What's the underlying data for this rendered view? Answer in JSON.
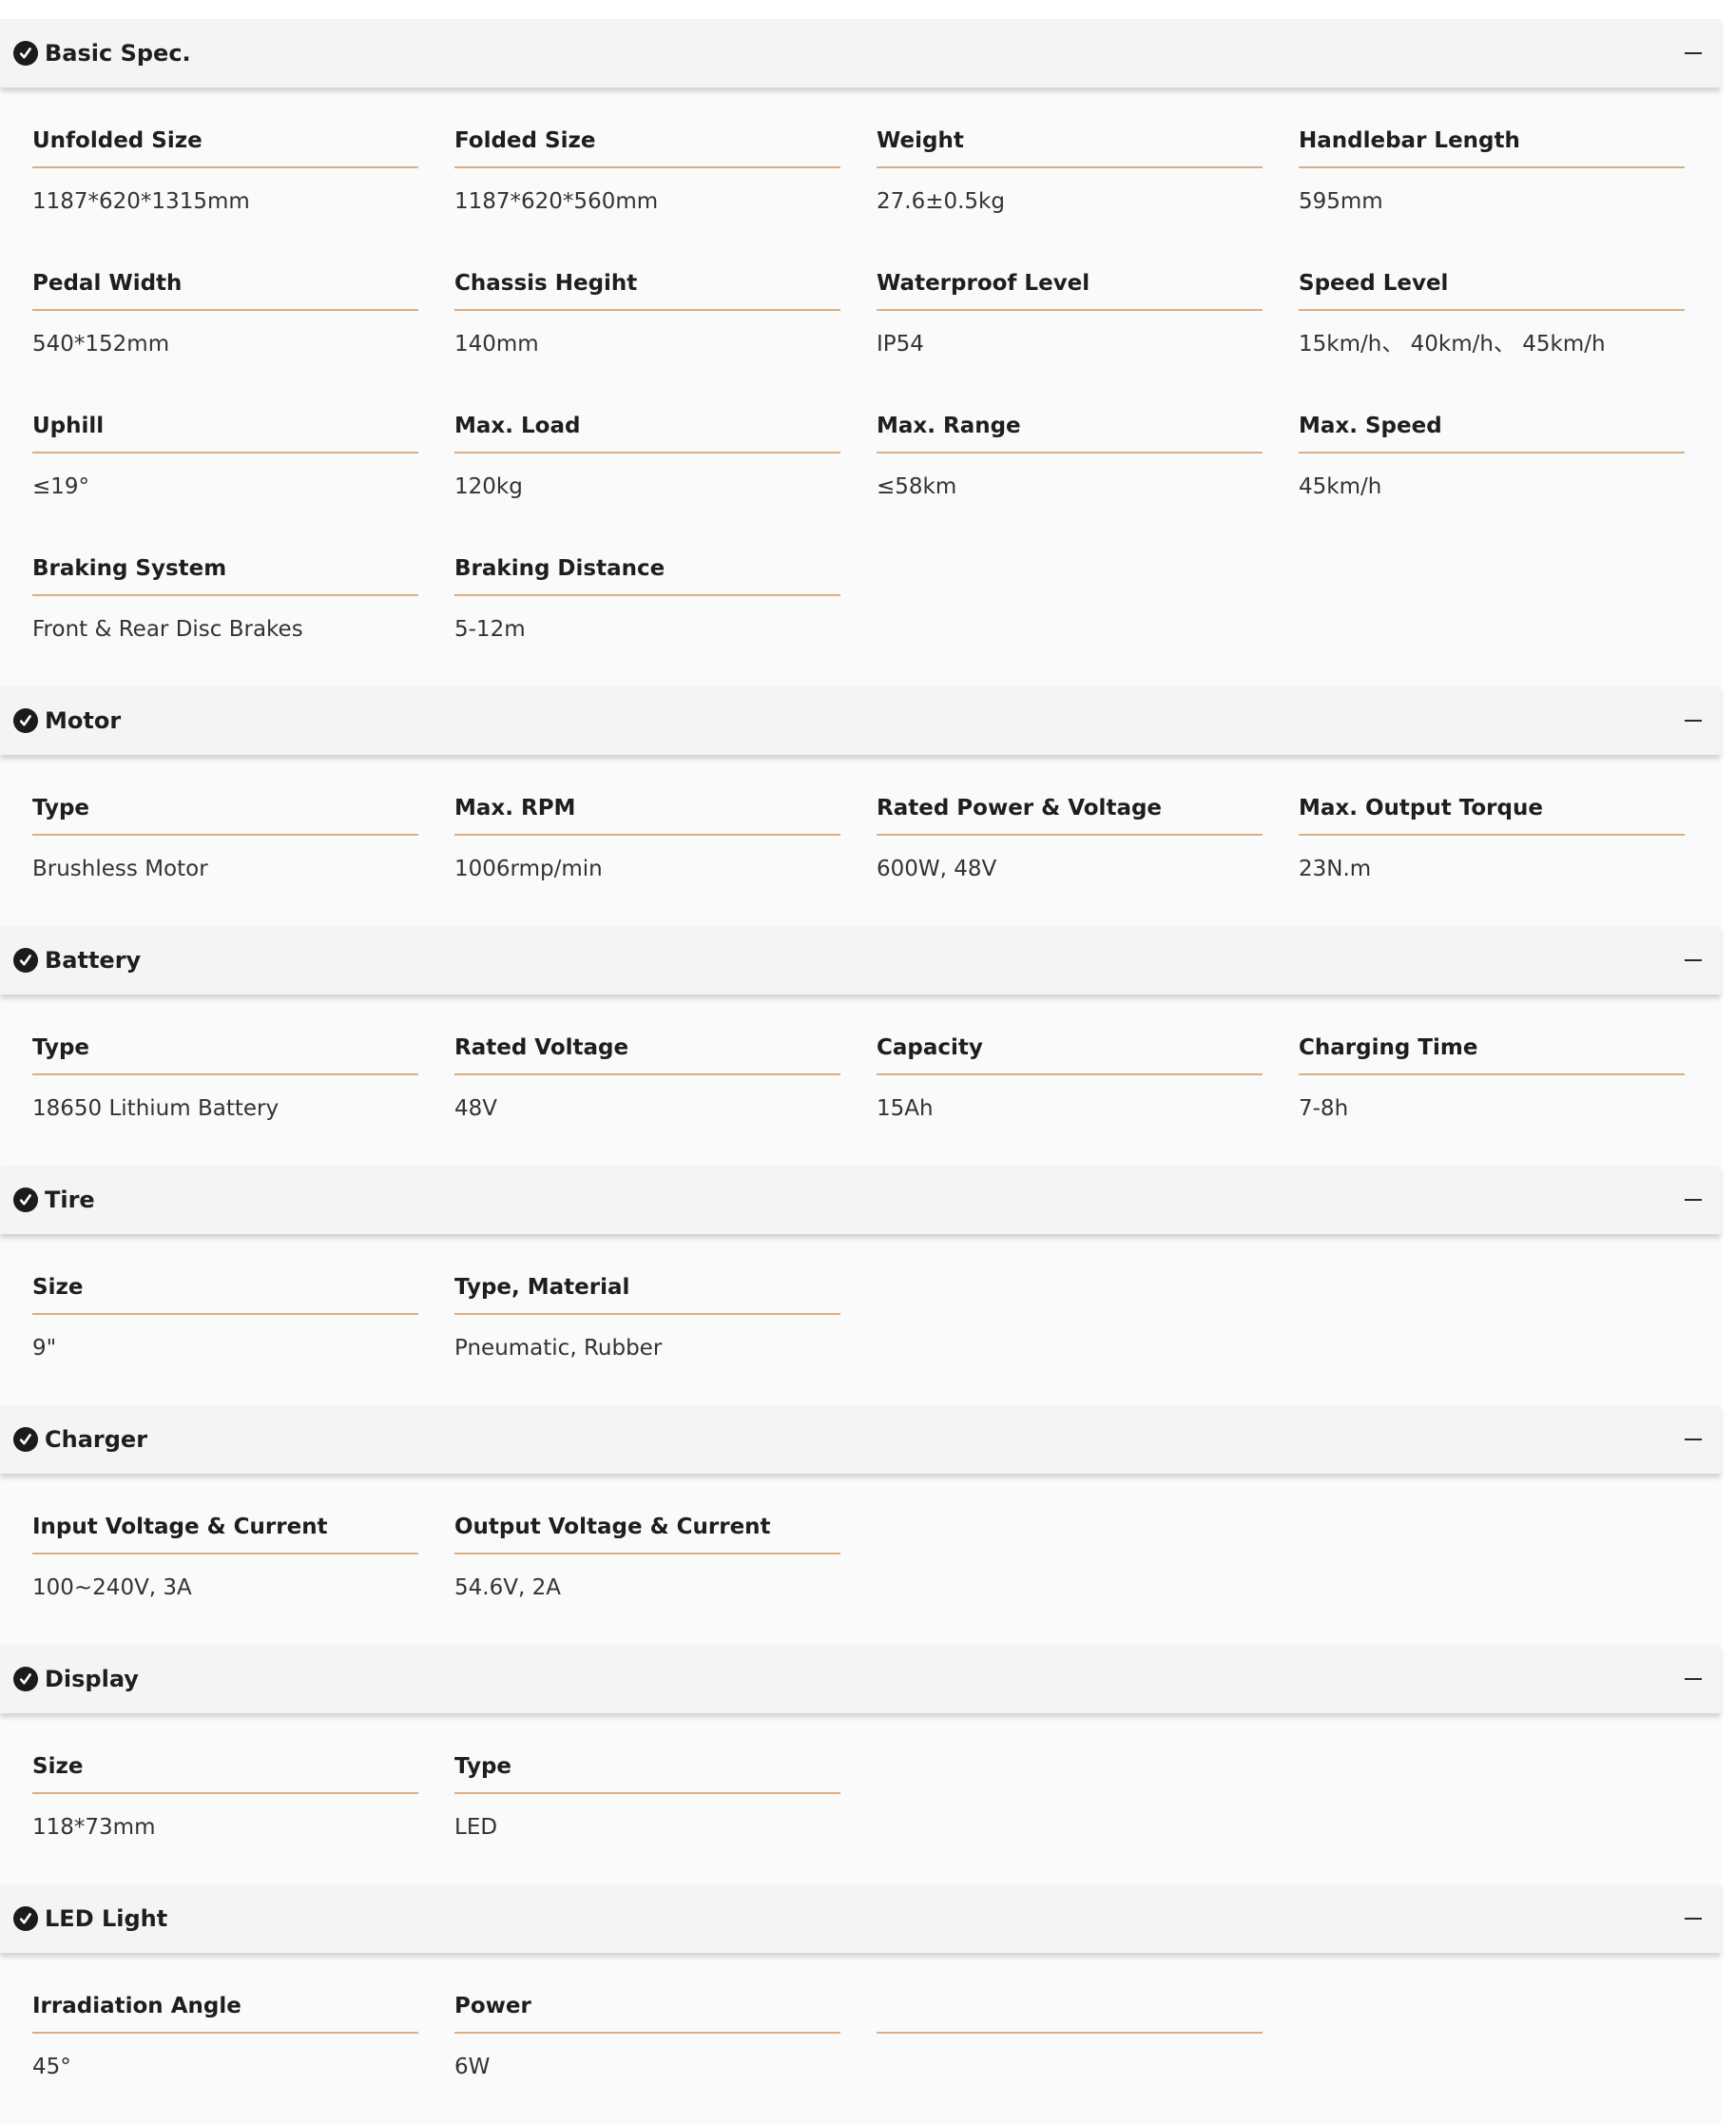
{
  "sections": [
    {
      "title": "Basic Spec.",
      "icon": "check-circle-icon",
      "rows": [
        [
          {
            "label": "Unfolded Size",
            "value": "1187*620*1315mm"
          },
          {
            "label": "Folded Size",
            "value": "1187*620*560mm"
          },
          {
            "label": "Weight",
            "value": "27.6±0.5kg"
          },
          {
            "label": "Handlebar Length",
            "value": "595mm"
          }
        ],
        [
          {
            "label": "Pedal Width",
            "value": "540*152mm"
          },
          {
            "label": "Chassis Hegiht",
            "value": "140mm"
          },
          {
            "label": "Waterproof Level",
            "value": "IP54"
          },
          {
            "label": "Speed Level",
            "value": "15km/h、 40km/h、 45km/h"
          }
        ],
        [
          {
            "label": "Uphill",
            "value": "≤19°"
          },
          {
            "label": "Max. Load",
            "value": "120kg"
          },
          {
            "label": "Max. Range",
            "value": "≤58km"
          },
          {
            "label": "Max. Speed",
            "value": "45km/h"
          }
        ],
        [
          {
            "label": "Braking System",
            "value": "Front & Rear Disc Brakes"
          },
          {
            "label": "Braking Distance",
            "value": "5-12m"
          }
        ]
      ]
    },
    {
      "title": "Motor",
      "icon": "check-circle-icon",
      "rows": [
        [
          {
            "label": "Type",
            "value": "Brushless Motor"
          },
          {
            "label": "Max. RPM",
            "value": "1006rmp/min"
          },
          {
            "label": "Rated Power & Voltage",
            "value": "600W, 48V"
          },
          {
            "label": "Max. Output Torque",
            "value": "23N.m"
          }
        ]
      ]
    },
    {
      "title": "Battery",
      "icon": "check-circle-icon",
      "rows": [
        [
          {
            "label": "Type",
            "value": "18650 Lithium Battery"
          },
          {
            "label": "Rated Voltage",
            "value": "48V"
          },
          {
            "label": "Capacity",
            "value": "15Ah"
          },
          {
            "label": "Charging Time",
            "value": "7-8h"
          }
        ]
      ]
    },
    {
      "title": "Tire",
      "icon": "check-circle-icon",
      "rows": [
        [
          {
            "label": "Size",
            "value": "9\""
          },
          {
            "label": "Type, Material",
            "value": "Pneumatic, Rubber"
          }
        ]
      ]
    },
    {
      "title": "Charger",
      "icon": "check-circle-icon",
      "rows": [
        [
          {
            "label": "Input Voltage & Current",
            "value": "100~240V, 3A"
          },
          {
            "label": "Output Voltage & Current",
            "value": "54.6V, 2A"
          }
        ]
      ]
    },
    {
      "title": "Display",
      "icon": "check-circle-icon",
      "rows": [
        [
          {
            "label": "Size",
            "value": "118*73mm"
          },
          {
            "label": "Type",
            "value": "LED"
          }
        ]
      ]
    },
    {
      "title": "LED Light",
      "icon": "check-circle-icon",
      "rows": [
        [
          {
            "label": "Irradiation Angle",
            "value": "45°"
          },
          {
            "label": "Power",
            "value": "6W"
          },
          {
            "label": "",
            "value": ""
          }
        ]
      ]
    }
  ],
  "collapse_icon": "minus-icon",
  "colors": {
    "header_bg": "#f4f4f4",
    "body_bg": "#fafafa",
    "divider": "#dcae85",
    "text": "#1e1e1e"
  }
}
